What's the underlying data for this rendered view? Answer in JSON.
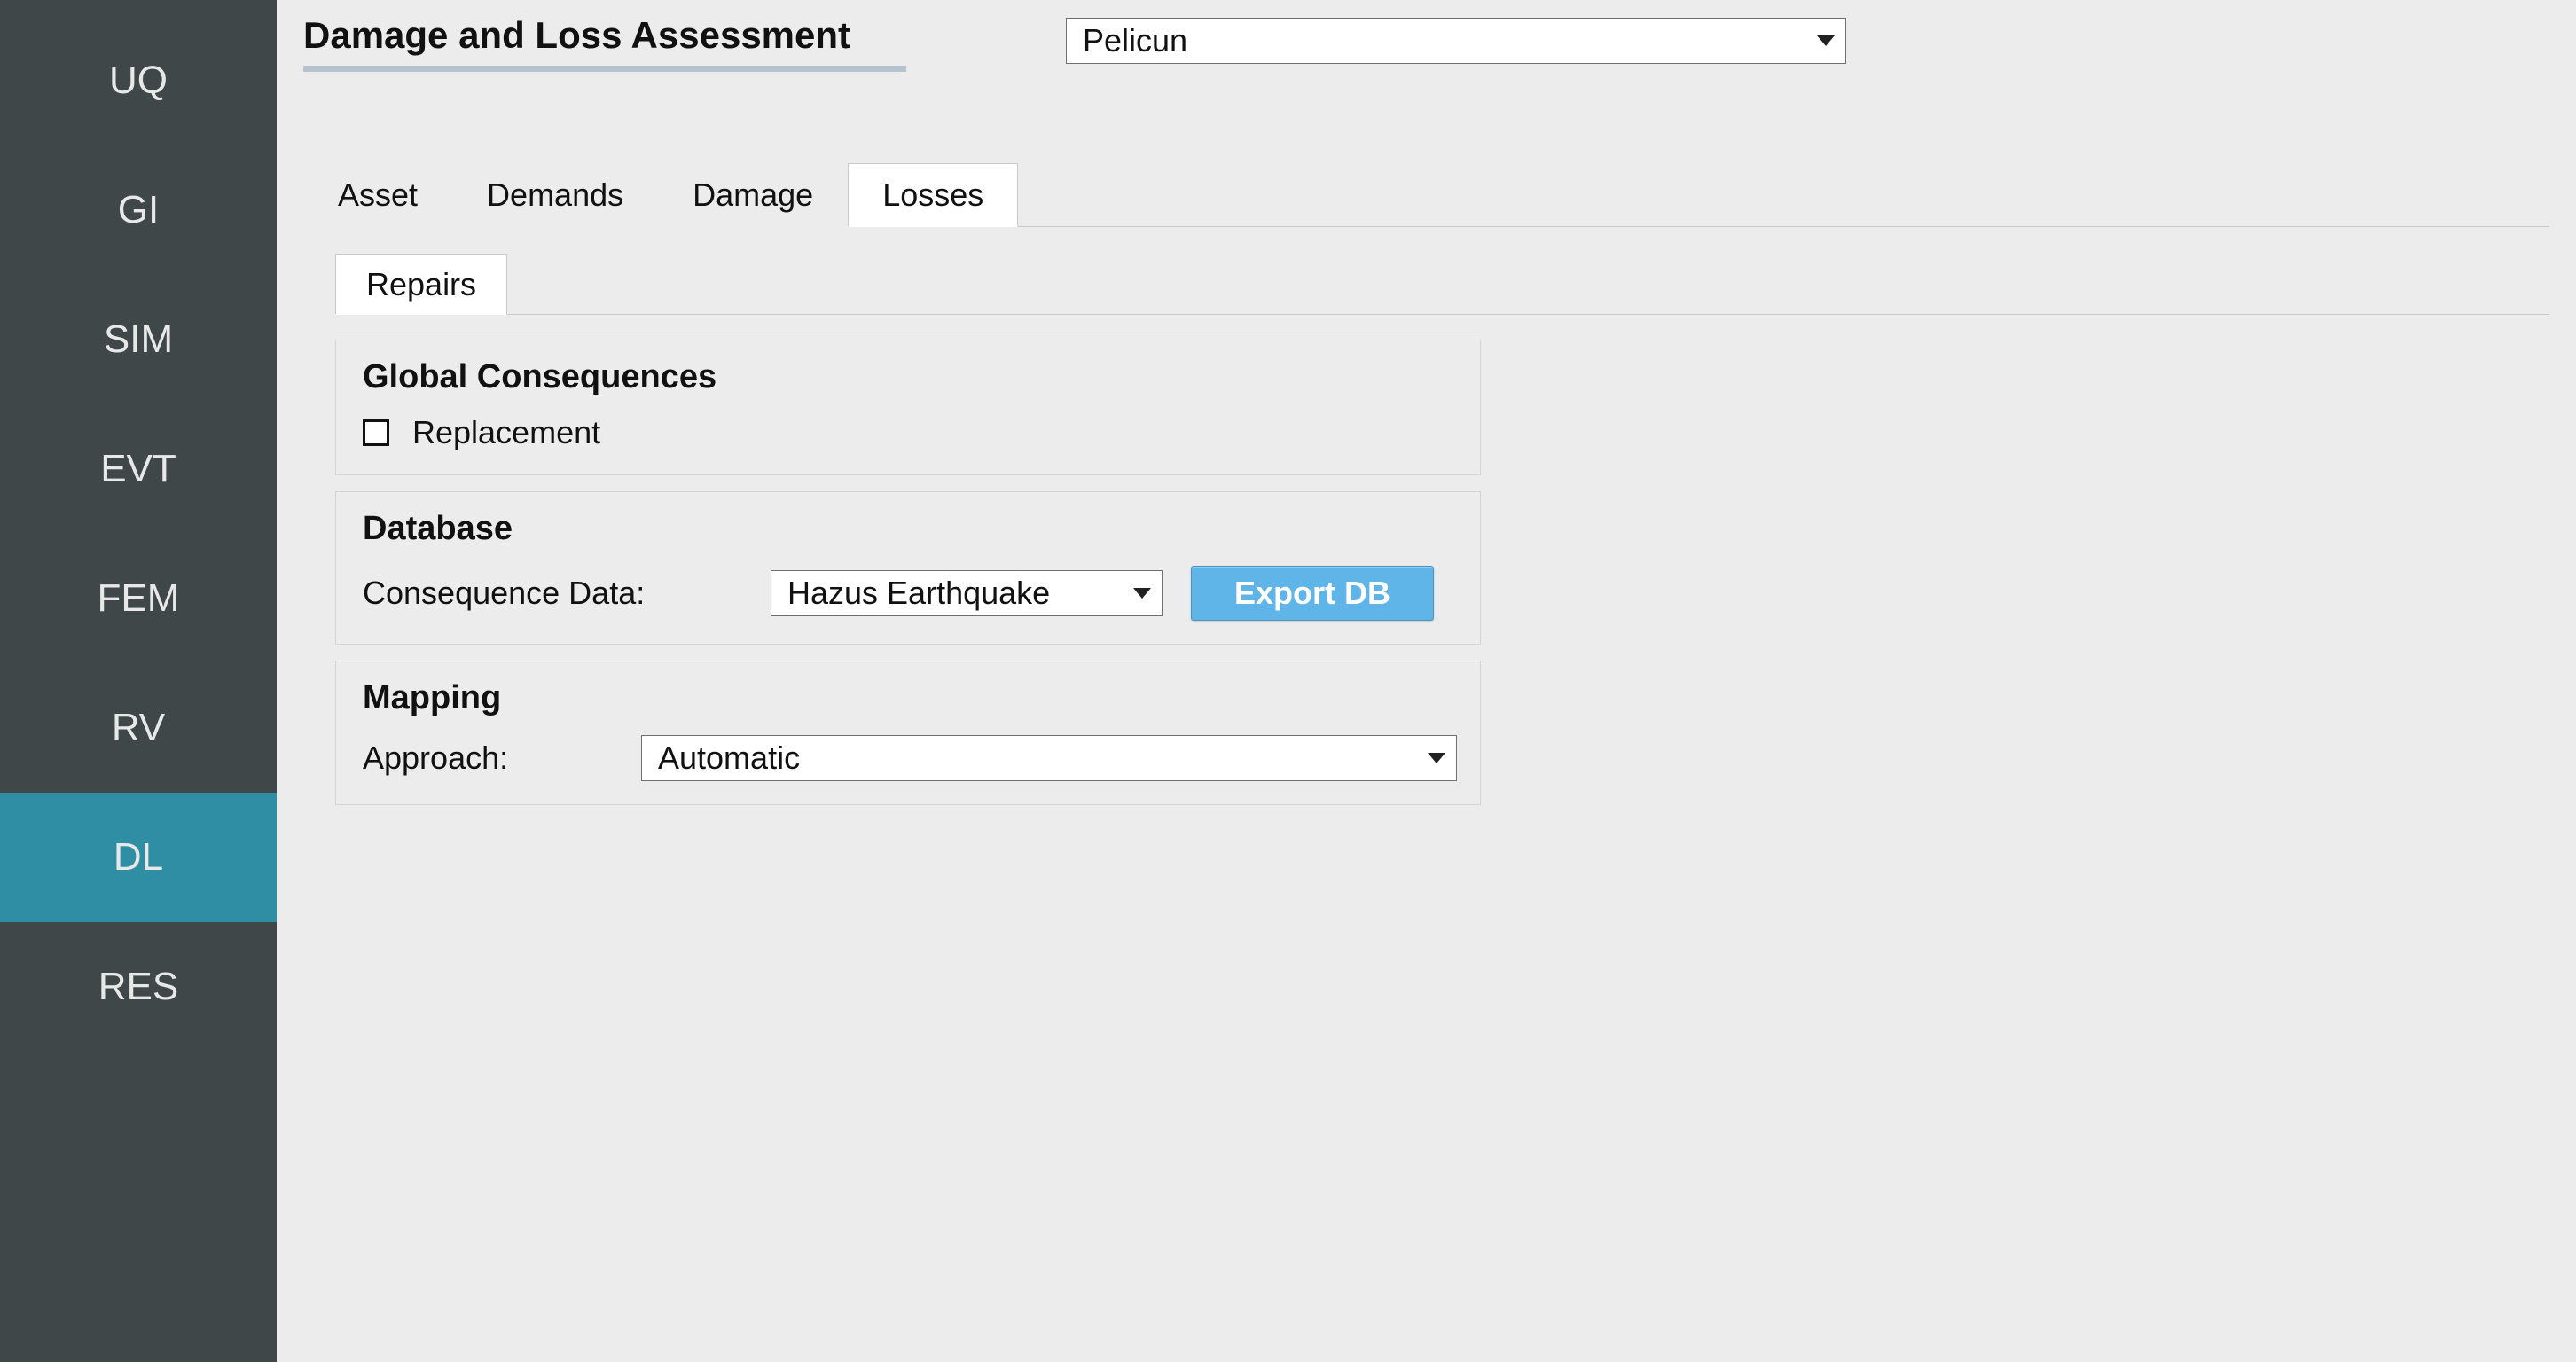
{
  "sidebar": {
    "items": [
      {
        "id": "uq",
        "label": "UQ",
        "active": false
      },
      {
        "id": "gi",
        "label": "GI",
        "active": false
      },
      {
        "id": "sim",
        "label": "SIM",
        "active": false
      },
      {
        "id": "evt",
        "label": "EVT",
        "active": false
      },
      {
        "id": "fem",
        "label": "FEM",
        "active": false
      },
      {
        "id": "rv",
        "label": "RV",
        "active": false
      },
      {
        "id": "dl",
        "label": "DL",
        "active": true
      },
      {
        "id": "res",
        "label": "RES",
        "active": false
      }
    ]
  },
  "header": {
    "title": "Damage and Loss Assessment",
    "engine_select": "Pelicun"
  },
  "tabs": {
    "items": [
      {
        "label": "Asset",
        "active": false
      },
      {
        "label": "Demands",
        "active": false
      },
      {
        "label": "Damage",
        "active": false
      },
      {
        "label": "Losses",
        "active": true
      }
    ]
  },
  "subtabs": {
    "items": [
      {
        "label": "Repairs",
        "active": true
      }
    ]
  },
  "panels": {
    "global": {
      "title": "Global Consequences",
      "replacement_label": "Replacement",
      "replacement_checked": false
    },
    "database": {
      "title": "Database",
      "consequence_label": "Consequence Data:",
      "consequence_value": "Hazus Earthquake",
      "export_button": "Export DB"
    },
    "mapping": {
      "title": "Mapping",
      "approach_label": "Approach:",
      "approach_value": "Automatic"
    }
  }
}
